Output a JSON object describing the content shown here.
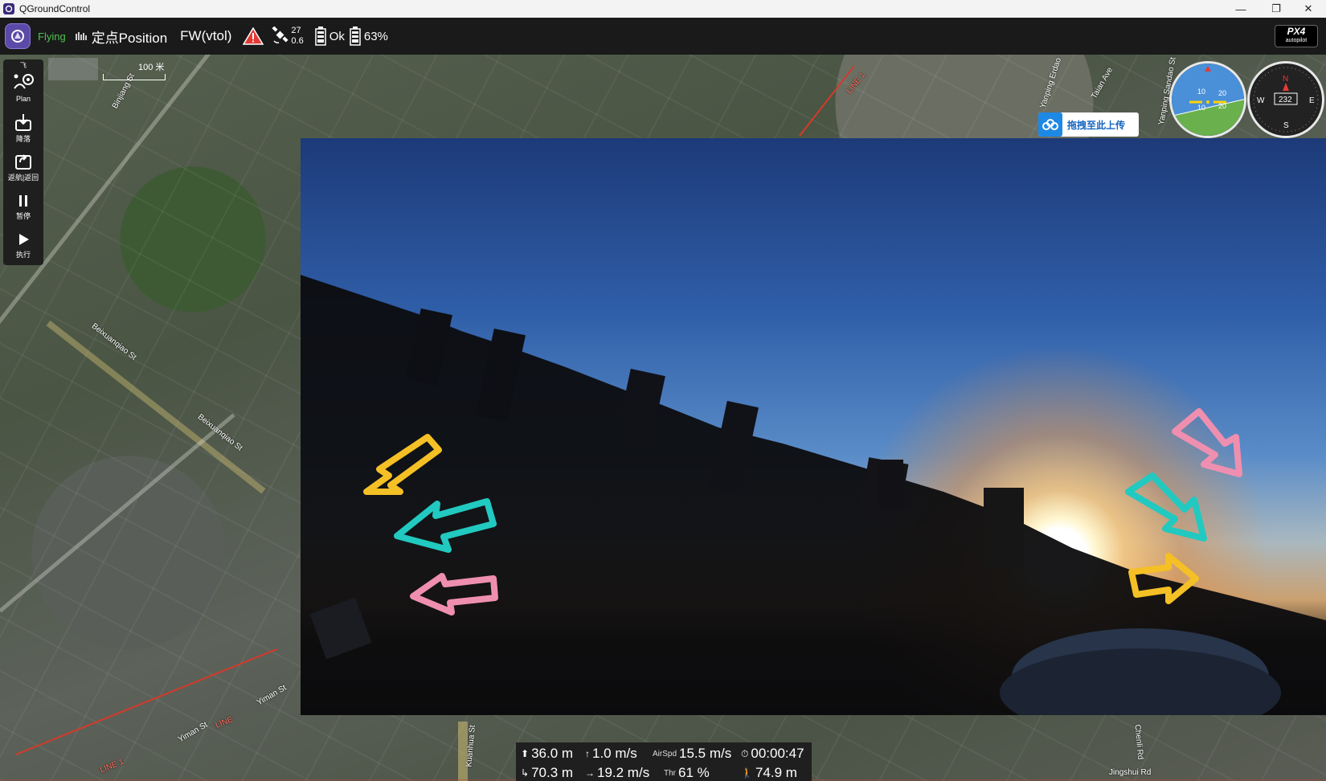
{
  "window": {
    "title": "QGroundControl",
    "minimize": "—",
    "restore": "❐",
    "close": "✕"
  },
  "toolbar": {
    "status": "Flying",
    "flight_mode": "定点Position",
    "vehicle_type": "FW(vtol)",
    "gps_count": "27",
    "gps_hdop": "0.6",
    "rc_status": "Ok",
    "battery": "63%",
    "brand": "PX4",
    "brand_sub": "autopilot"
  },
  "left_toolbar": {
    "top_label": "飞",
    "items": [
      {
        "label": "Plan"
      },
      {
        "label": "降落"
      },
      {
        "label": "返航|返回"
      },
      {
        "label": "暂停"
      },
      {
        "label": "执行"
      }
    ]
  },
  "map": {
    "scale_label": "100 米",
    "streets": [
      "Binjiang St",
      "Beixuanqiao St",
      "Beixuanqiao St",
      "Yiman St",
      "Yiman St",
      "Taian Ave",
      "Yanping Erdao",
      "Yanping Sandao St",
      "Kuanhua St",
      "Jingshui Rd",
      "Chenli Rd"
    ],
    "line_labels": [
      "LINE",
      "LINE 1",
      "LINE 1"
    ]
  },
  "upload_button": {
    "label": "拖拽至此上传"
  },
  "instruments": {
    "pitch_ticks": [
      "20",
      "10",
      "10",
      "20"
    ],
    "heading": "232",
    "compass": {
      "n": "N",
      "e": "E",
      "s": "S",
      "w": "W"
    }
  },
  "telemetry": {
    "altitude": "36.0 m",
    "climb_rate": "1.0 m/s",
    "airspeed_label": "AirSpd",
    "airspeed": "15.5 m/s",
    "flight_time": "00:00:47",
    "distance": "70.3 m",
    "ground_speed": "19.2 m/s",
    "throttle_label": "Thr",
    "throttle": "61 %",
    "home_distance": "74.9 m"
  },
  "colors": {
    "accent": "#5b4aa8",
    "flying": "#4fc24f",
    "warning": "#e53935"
  }
}
